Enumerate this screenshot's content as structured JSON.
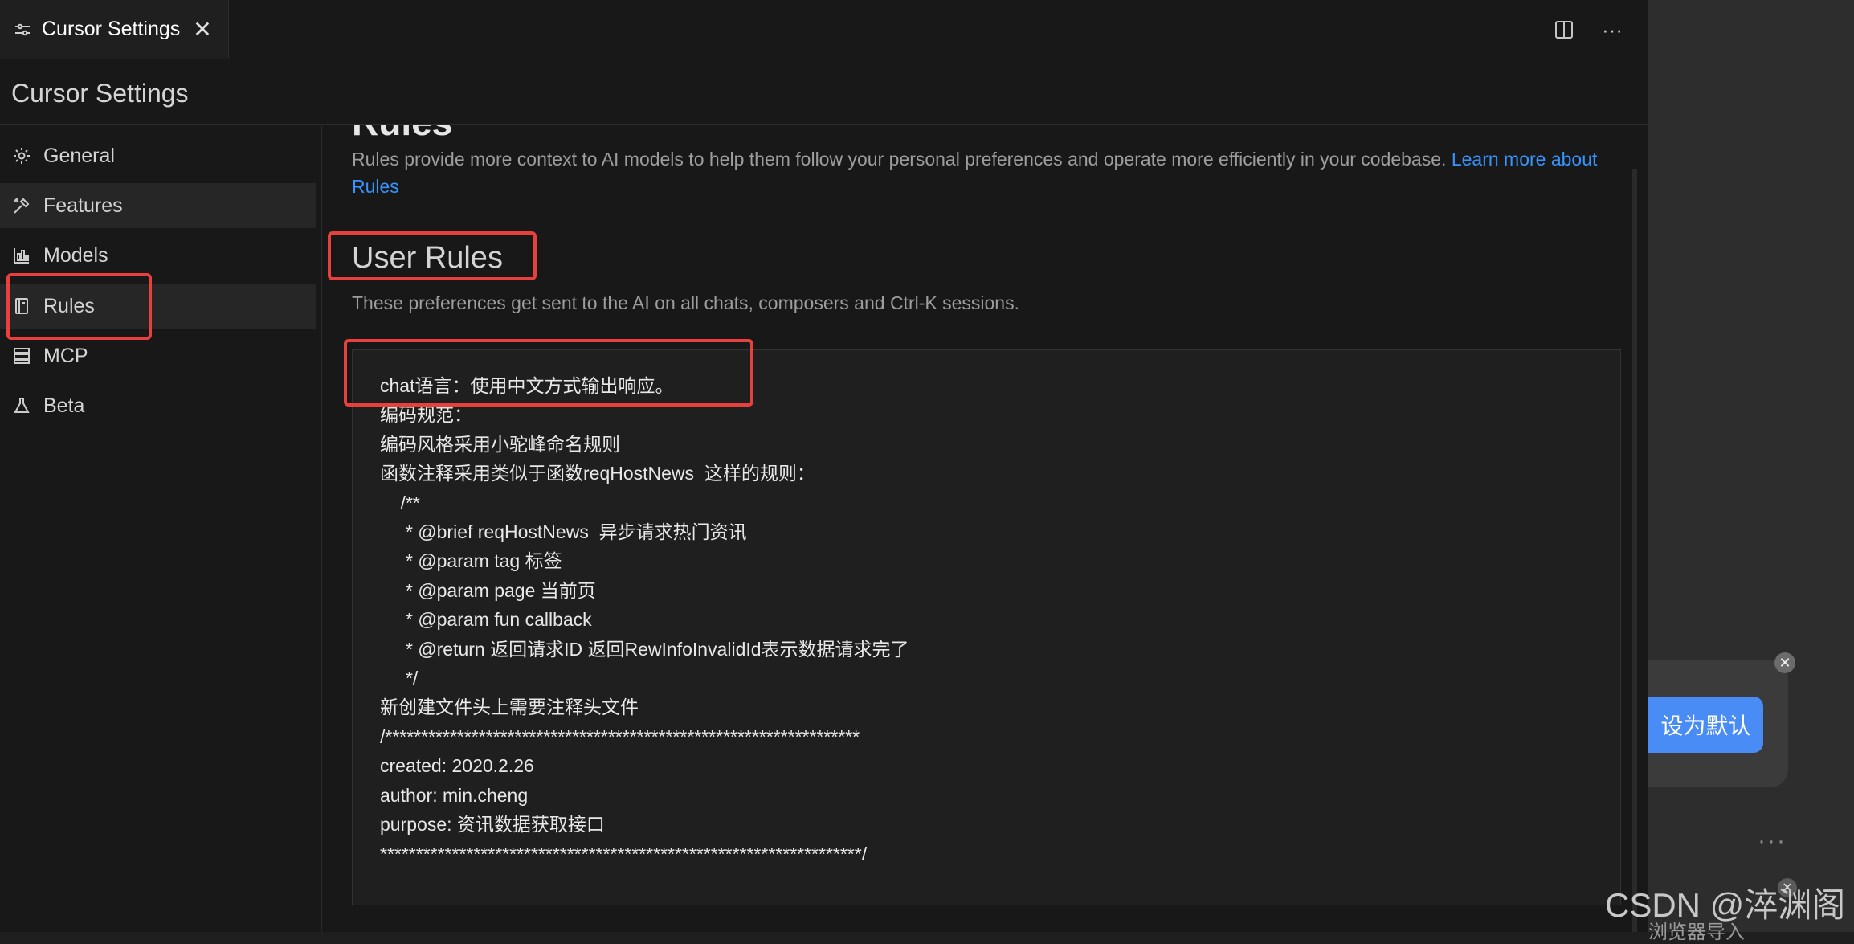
{
  "tab": {
    "label": "Cursor Settings",
    "close_glyph": "✕",
    "icon": "settings-sliders-icon"
  },
  "tab_actions": {
    "split_icon": "split-editor-icon",
    "more_glyph": "···"
  },
  "page_title": "Cursor Settings",
  "sidebar": {
    "items": [
      {
        "label": "General",
        "icon": "gear-icon"
      },
      {
        "label": "Features",
        "icon": "tools-icon"
      },
      {
        "label": "Models",
        "icon": "bar-chart-icon"
      },
      {
        "label": "Rules",
        "icon": "book-icon"
      },
      {
        "label": "MCP",
        "icon": "server-icon"
      },
      {
        "label": "Beta",
        "icon": "flask-icon"
      }
    ],
    "active": "Rules"
  },
  "main": {
    "section_title": "Rules",
    "section_desc": "Rules provide more context to AI models to help them follow your personal preferences and operate more efficiently in your codebase.",
    "learn_more": "Learn more about Rules",
    "user_rules_title": "User Rules",
    "user_rules_desc": "These preferences get sent to the AI on all chats, composers and Ctrl-K sessions.",
    "rules_text": "chat语言：使用中文方式输出响应。\n编码规范：\n编码风格采用小驼峰命名规则\n函数注释采用类似于函数reqHostNews  这样的规则：\n    /**\n     * @brief reqHostNews  异步请求热门资讯\n     * @param tag 标签\n     * @param page 当前页\n     * @param fun callback\n     * @return 返回请求ID 返回RewInfoInvalidId表示数据请求完了\n     */\n新创建文件头上需要注释头文件\n/******************************************************************\ncreated: 2020.2.26\nauthor: min.cheng\npurpose: 资讯数据获取接口\n*******************************************************************/"
  },
  "overlay": {
    "default_button": "设为默认",
    "close_glyph": "✕",
    "more_glyph": "···",
    "bottom_partial_text": "浏览器导入",
    "watermark": "CSDN @淬渊阁"
  },
  "colors": {
    "accent_link": "#3794ff",
    "highlight_red": "#e8403d",
    "button_blue": "#4a8cf5"
  }
}
